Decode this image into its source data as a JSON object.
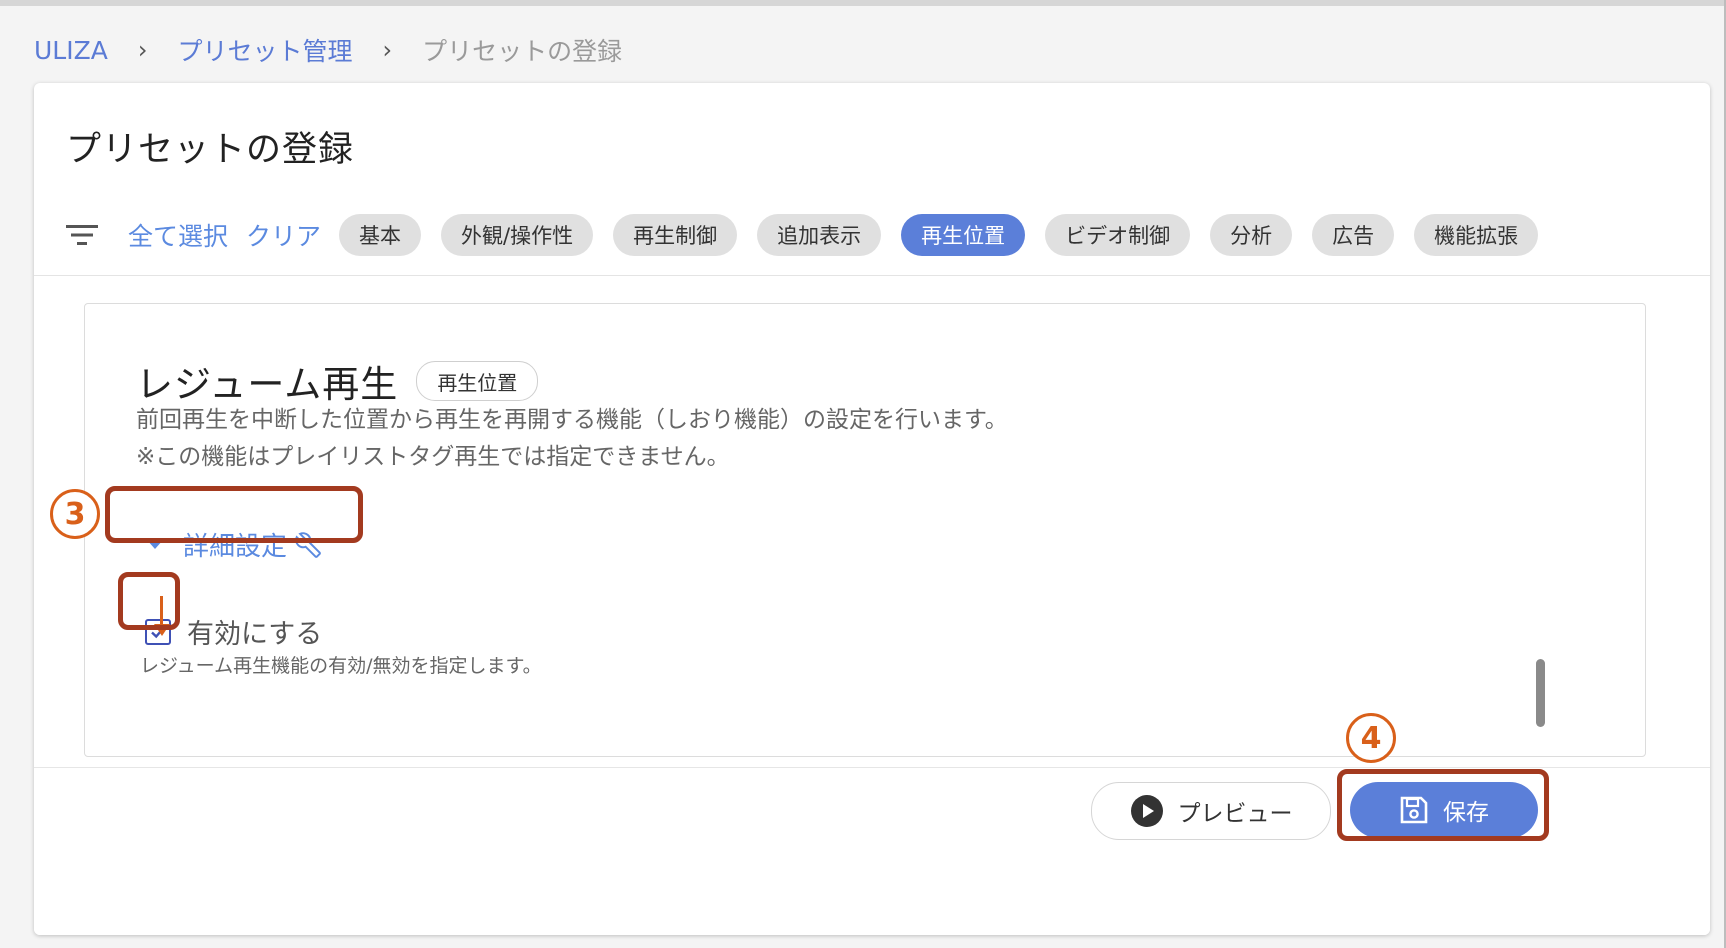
{
  "breadcrumb": {
    "items": [
      {
        "label": "ULIZA"
      },
      {
        "label": "プリセット管理"
      }
    ],
    "current": "プリセットの登録",
    "separator": "›"
  },
  "page": {
    "title": "プリセットの登録"
  },
  "filter": {
    "select_all": "全て選択",
    "clear": "クリア",
    "chips": [
      {
        "label": "基本",
        "active": false
      },
      {
        "label": "外観/操作性",
        "active": false
      },
      {
        "label": "再生制御",
        "active": false
      },
      {
        "label": "追加表示",
        "active": false
      },
      {
        "label": "再生位置",
        "active": true
      },
      {
        "label": "ビデオ制御",
        "active": false
      },
      {
        "label": "分析",
        "active": false
      },
      {
        "label": "広告",
        "active": false
      },
      {
        "label": "機能拡張",
        "active": false
      }
    ]
  },
  "section": {
    "title": "レジューム再生",
    "tag": "再生位置",
    "description_1": "前回再生を中断した位置から再生を再開する機能（しおり機能）の設定を行います。",
    "description_2": "※この機能はプレイリストタグ再生では指定できません。",
    "detail_toggle": "詳細設定",
    "enable_label": "有効にする",
    "enable_checked": true,
    "enable_hint": "レジューム再生機能の有効/無効を指定します。"
  },
  "footer": {
    "preview_label": "プレビュー",
    "save_label": "保存"
  },
  "annotations": {
    "step3": "3",
    "step4": "4"
  },
  "colors": {
    "accent": "#5b7fd9",
    "link": "#5b8ae0",
    "highlight": "#a33a1f",
    "annotation": "#d9601a"
  }
}
